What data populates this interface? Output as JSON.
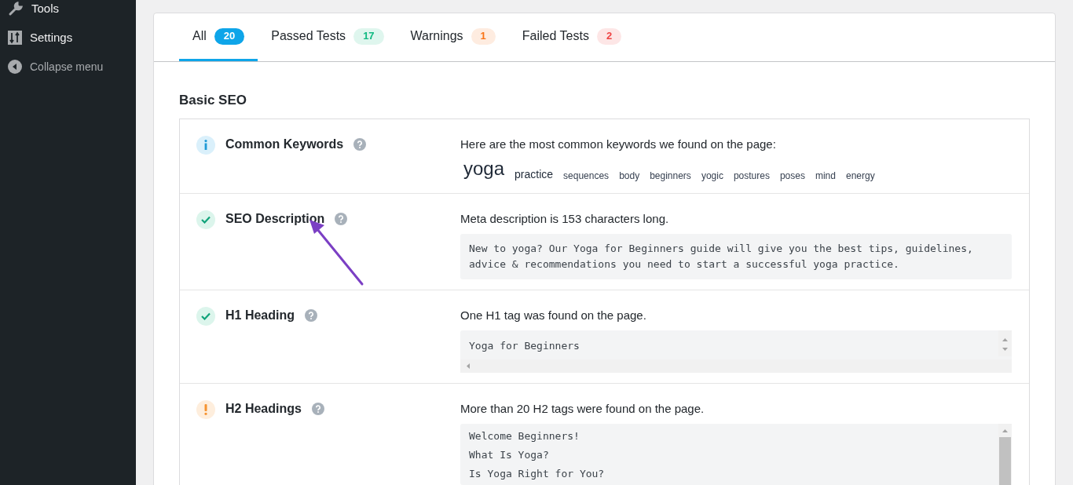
{
  "sidebar": {
    "items": [
      {
        "label": "Tools",
        "kind": "tools"
      },
      {
        "label": "Settings",
        "kind": "settings"
      },
      {
        "label": "Collapse menu",
        "kind": "collapse"
      }
    ]
  },
  "tabs": [
    {
      "label": "All",
      "count": "20",
      "selected": true,
      "color": "#0ea5e9"
    },
    {
      "label": "Passed Tests",
      "count": "17",
      "selected": false,
      "color": "#10b981"
    },
    {
      "label": "Warnings",
      "count": "1",
      "selected": false,
      "color": "#f97316"
    },
    {
      "label": "Failed Tests",
      "count": "2",
      "selected": false,
      "color": "#ef4444"
    }
  ],
  "section_title": "Basic SEO",
  "tests": [
    {
      "kind": "info",
      "title": "Common Keywords",
      "message": "Here are the most common keywords we found on the page:",
      "keywords": [
        {
          "word": "yoga",
          "kind": "large"
        },
        {
          "word": "practice",
          "kind": "medium"
        },
        {
          "word": "sequences",
          "kind": "small"
        },
        {
          "word": "body",
          "kind": "small"
        },
        {
          "word": "beginners",
          "kind": "small"
        },
        {
          "word": "yogic",
          "kind": "small"
        },
        {
          "word": "postures",
          "kind": "small"
        },
        {
          "word": "poses",
          "kind": "small"
        },
        {
          "word": "mind",
          "kind": "small"
        },
        {
          "word": "energy",
          "kind": "small"
        }
      ]
    },
    {
      "kind": "pass",
      "title": "SEO Description",
      "message": "Meta description is 153 characters long.",
      "code": {
        "kind": "plain",
        "lines": [
          "New to yoga? Our Yoga for Beginners guide will give you the best tips, guidelines, advice & recommendations you need to start a successful yoga practice."
        ]
      }
    },
    {
      "kind": "pass",
      "title": "H1 Heading",
      "message": "One H1 tag was found on the page.",
      "code": {
        "kind": "both_scrollbars",
        "lines": [
          "Yoga for Beginners"
        ]
      }
    },
    {
      "kind": "warning",
      "title": "H2 Headings",
      "message": "More than 20 H2 tags were found on the page.",
      "code": {
        "kind": "vertical_scrollbar",
        "lines": [
          "Welcome Beginners!",
          "What Is Yoga?",
          "Is Yoga Right for You?"
        ]
      }
    }
  ]
}
